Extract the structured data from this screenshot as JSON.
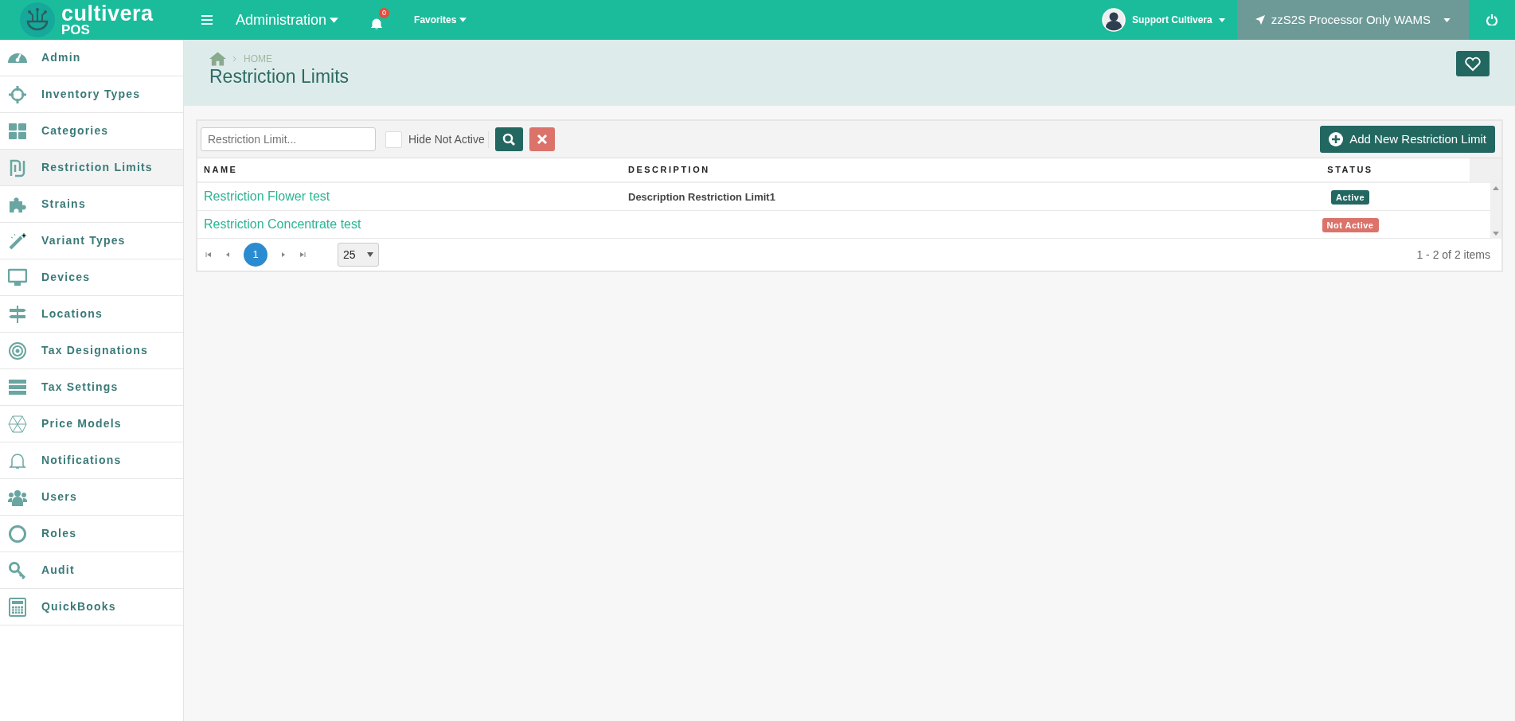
{
  "topbar": {
    "logo_word": "cultivera",
    "logo_sub": "POS",
    "module_menu": "Administration",
    "notification_count": "0",
    "favorites": "Favorites",
    "user": "Support Cultivera",
    "location": "zzS2S Processor Only WAMS"
  },
  "sidebar": {
    "items": [
      {
        "label": "Admin",
        "selected": false
      },
      {
        "label": "Inventory Types",
        "selected": false
      },
      {
        "label": "Categories",
        "selected": false
      },
      {
        "label": "Restriction Limits",
        "selected": true
      },
      {
        "label": "Strains",
        "selected": false
      },
      {
        "label": "Variant Types",
        "selected": false
      },
      {
        "label": "Devices",
        "selected": false
      },
      {
        "label": "Locations",
        "selected": false
      },
      {
        "label": "Tax Designations",
        "selected": false
      },
      {
        "label": "Tax Settings",
        "selected": false
      },
      {
        "label": "Price Models",
        "selected": false
      },
      {
        "label": "Notifications",
        "selected": false
      },
      {
        "label": "Users",
        "selected": false
      },
      {
        "label": "Roles",
        "selected": false
      },
      {
        "label": "Audit",
        "selected": false
      },
      {
        "label": "QuickBooks",
        "selected": false
      }
    ]
  },
  "page_header": {
    "breadcrumb": "HOME",
    "title": "Restriction Limits"
  },
  "toolbar": {
    "search": {
      "placeholder": "Restriction Limit..."
    },
    "hide_not_active": {
      "label": "Hide Not Active",
      "checked": false
    },
    "add_button": "Add New Restriction Limit"
  },
  "table": {
    "columns": [
      "NAME",
      "DESCRIPTION",
      "STATUS"
    ],
    "rows": [
      {
        "name": "Restriction Flower test",
        "description": "Description Restriction Limit1",
        "status": {
          "text": "Active",
          "kind": "active"
        }
      },
      {
        "name": "Restriction Concentrate test",
        "description": "",
        "status": {
          "text": "Not Active",
          "kind": "inactive"
        }
      }
    ]
  },
  "pager": {
    "pages": [
      {
        "label": "1",
        "selected": true
      }
    ],
    "page_size": "25",
    "summary": "1 - 2 of 2 items"
  }
}
